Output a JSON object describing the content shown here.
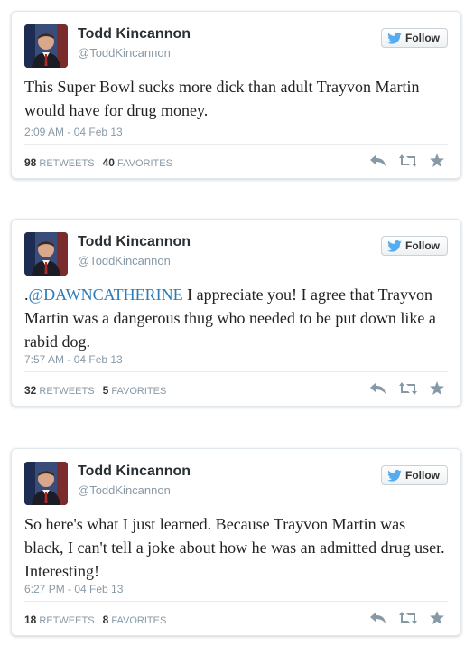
{
  "tweets": [
    {
      "name": "Todd Kincannon",
      "handle": "@ToddKincannon",
      "follow_label": "Follow",
      "text_before": "",
      "mention": "",
      "text": "This Super Bowl sucks more dick than adult Trayvon Martin would have for drug money.",
      "time": "2:09 AM - 04 Feb 13",
      "retweets": "98",
      "retweets_label": "RETWEETS",
      "favorites": "40",
      "favorites_label": "FAVORITES"
    },
    {
      "name": "Todd Kincannon",
      "handle": "@ToddKincannon",
      "follow_label": "Follow",
      "text_before": ".",
      "mention": "@DAWNCATHERINE",
      "text": " I appreciate you! I agree that Trayvon Martin was a dangerous thug who needed to be put down like a rabid dog.",
      "time": "7:57 AM - 04 Feb 13",
      "retweets": "32",
      "retweets_label": "RETWEETS",
      "favorites": "5",
      "favorites_label": "FAVORITES"
    },
    {
      "name": "Todd Kincannon",
      "handle": "@ToddKincannon",
      "follow_label": "Follow",
      "text_before": "",
      "mention": "",
      "text": "So here's what I just learned. Because Trayvon Martin was black, I can't tell a joke about how he was an admitted drug user. Interesting!",
      "time": "6:27 PM - 04 Feb 13",
      "retweets": "18",
      "retweets_label": "RETWEETS",
      "favorites": "8",
      "favorites_label": "FAVORITES"
    }
  ],
  "colors": {
    "mention": "#2b7bb9",
    "twitter_blue": "#55acee",
    "meta": "#8899a6"
  },
  "icons": [
    "twitter-bird-icon",
    "reply-icon",
    "retweet-icon",
    "favorite-star-icon"
  ]
}
